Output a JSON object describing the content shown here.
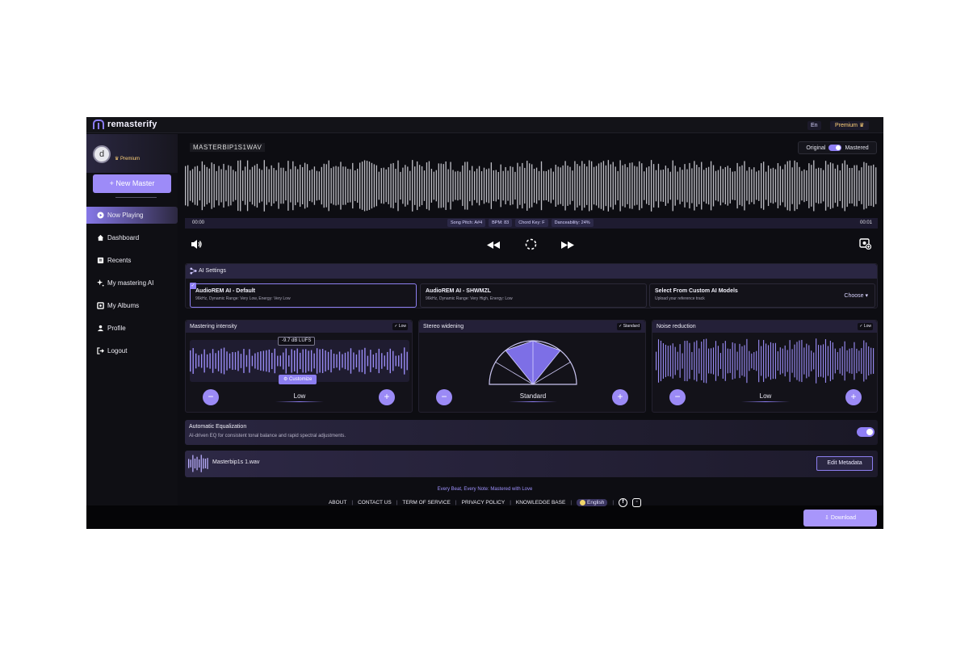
{
  "app": {
    "name": "remasterify"
  },
  "topbar": {
    "language": "En",
    "premium": "Premium ♛"
  },
  "sidebar": {
    "user_initial": "d",
    "user_badge": "♛ Premium",
    "new_master_label": "+ New Master",
    "items": [
      {
        "label": "Now Playing",
        "icon": "play-icon"
      },
      {
        "label": "Dashboard",
        "icon": "home-icon"
      },
      {
        "label": "Recents",
        "icon": "recents-icon"
      },
      {
        "label": "My mastering AI",
        "icon": "sparkle-icon"
      },
      {
        "label": "My Albums",
        "icon": "album-icon"
      },
      {
        "label": "Profile",
        "icon": "user-icon"
      },
      {
        "label": "Logout",
        "icon": "logout-icon"
      }
    ]
  },
  "player": {
    "track_title": "MASTERBIP1S1WAV",
    "compare": {
      "left": "Original",
      "right": "Mastered",
      "state": "Mastered"
    },
    "time_start": "00:00",
    "time_end": "00:01",
    "chips": [
      {
        "icon": "pitch-icon",
        "label": "Song Pitch: A#4"
      },
      {
        "icon": "bpm-icon",
        "label": "BPM: 83"
      },
      {
        "icon": "key-icon",
        "label": "Chord Key: F"
      },
      {
        "icon": "dance-icon",
        "label": "Danceability: 24%"
      }
    ]
  },
  "ai_settings": {
    "title": "AI Settings",
    "models": [
      {
        "name": "AudioREM AI - Default",
        "desc": "96kHz, Dynamic Range: Very Low, Energy: Very Low",
        "selected": true
      },
      {
        "name": "AudioREM AI - SHWMZL",
        "desc": "96kHz, Dynamic Range: Very High, Energy: Low",
        "selected": false
      },
      {
        "name": "Select From Custom AI Models",
        "desc": "Upload your reference track",
        "selected": false
      }
    ],
    "choose_label": "Choose ▾"
  },
  "panels": {
    "intensity": {
      "title": "Mastering intensity",
      "badge": "✓ Low",
      "lufs": "-9.7 dB LUFS",
      "customize": "⚙ Customize",
      "level": "Low"
    },
    "stereo": {
      "title": "Stereo widening",
      "badge": "✓ Standard",
      "level": "Standard"
    },
    "noise": {
      "title": "Noise reduction",
      "badge": "✓ Low",
      "level": "Low"
    }
  },
  "auto_eq": {
    "title": "Automatic Equalization",
    "desc": "AI-driven EQ for consistent tonal balance and rapid spectral adjustments.",
    "enabled": true
  },
  "file": {
    "name": "Masterbip1s 1.wav",
    "edit_label": "Edit Metadata"
  },
  "footer": {
    "tagline": "Every Beat, Every Note: Mastered with Love",
    "links": [
      "ABOUT",
      "CONTACT US",
      "TERM OF SERVICE",
      "PRIVACY POLICY",
      "KNOWLEDGE BASE"
    ],
    "language": "English"
  },
  "download_label": "⇩ Download",
  "colors": {
    "accent": "#8f7ff5",
    "background": "#0d0d12",
    "premium": "#ffd27a"
  }
}
